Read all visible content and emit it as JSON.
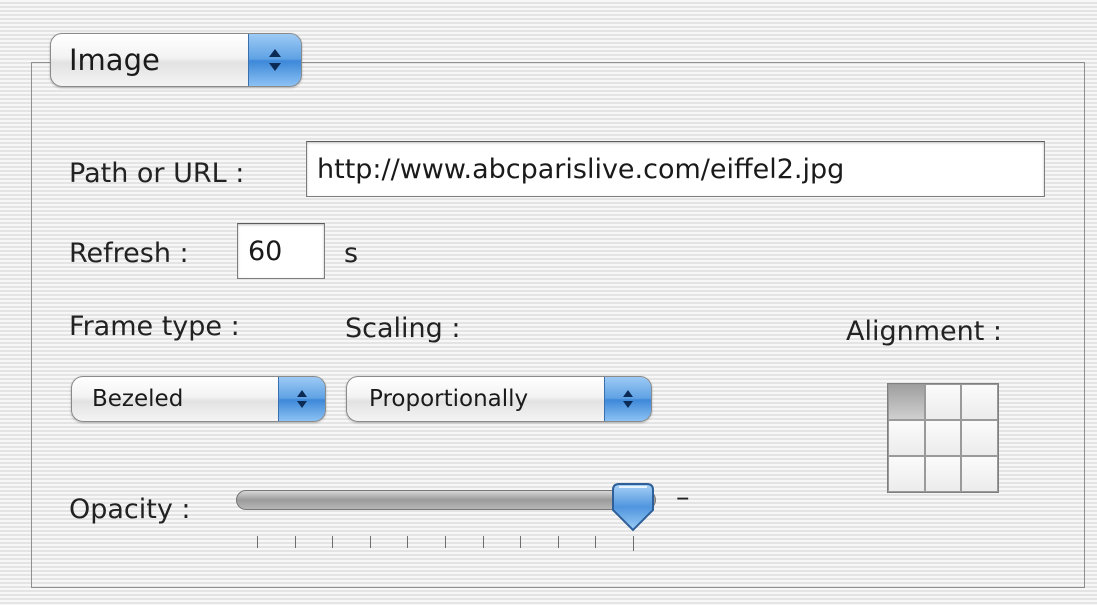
{
  "source_popup": {
    "label": "Image"
  },
  "path": {
    "label": "Path or URL :",
    "value": "http://www.abcparislive.com/eiffel2.jpg"
  },
  "refresh": {
    "label": "Refresh :",
    "value": "60",
    "unit": "s"
  },
  "frame_type": {
    "label": "Frame type :",
    "selected": "Bezeled"
  },
  "scaling": {
    "label": "Scaling :",
    "selected": "Proportionally"
  },
  "alignment": {
    "label": "Alignment :",
    "selected_cell": "top-left"
  },
  "opacity": {
    "label": "Opacity :",
    "value_fraction": 1.0,
    "max_marker": "–",
    "tick_count": 11
  },
  "colors": {
    "accent": "#5fa2e4",
    "stripe_light": "#f7f7f7",
    "stripe_dark": "#e4e4e4"
  },
  "icons": {
    "popup_arrows": "updown-arrows-icon",
    "slider_thumb": "slider-thumb-icon"
  }
}
